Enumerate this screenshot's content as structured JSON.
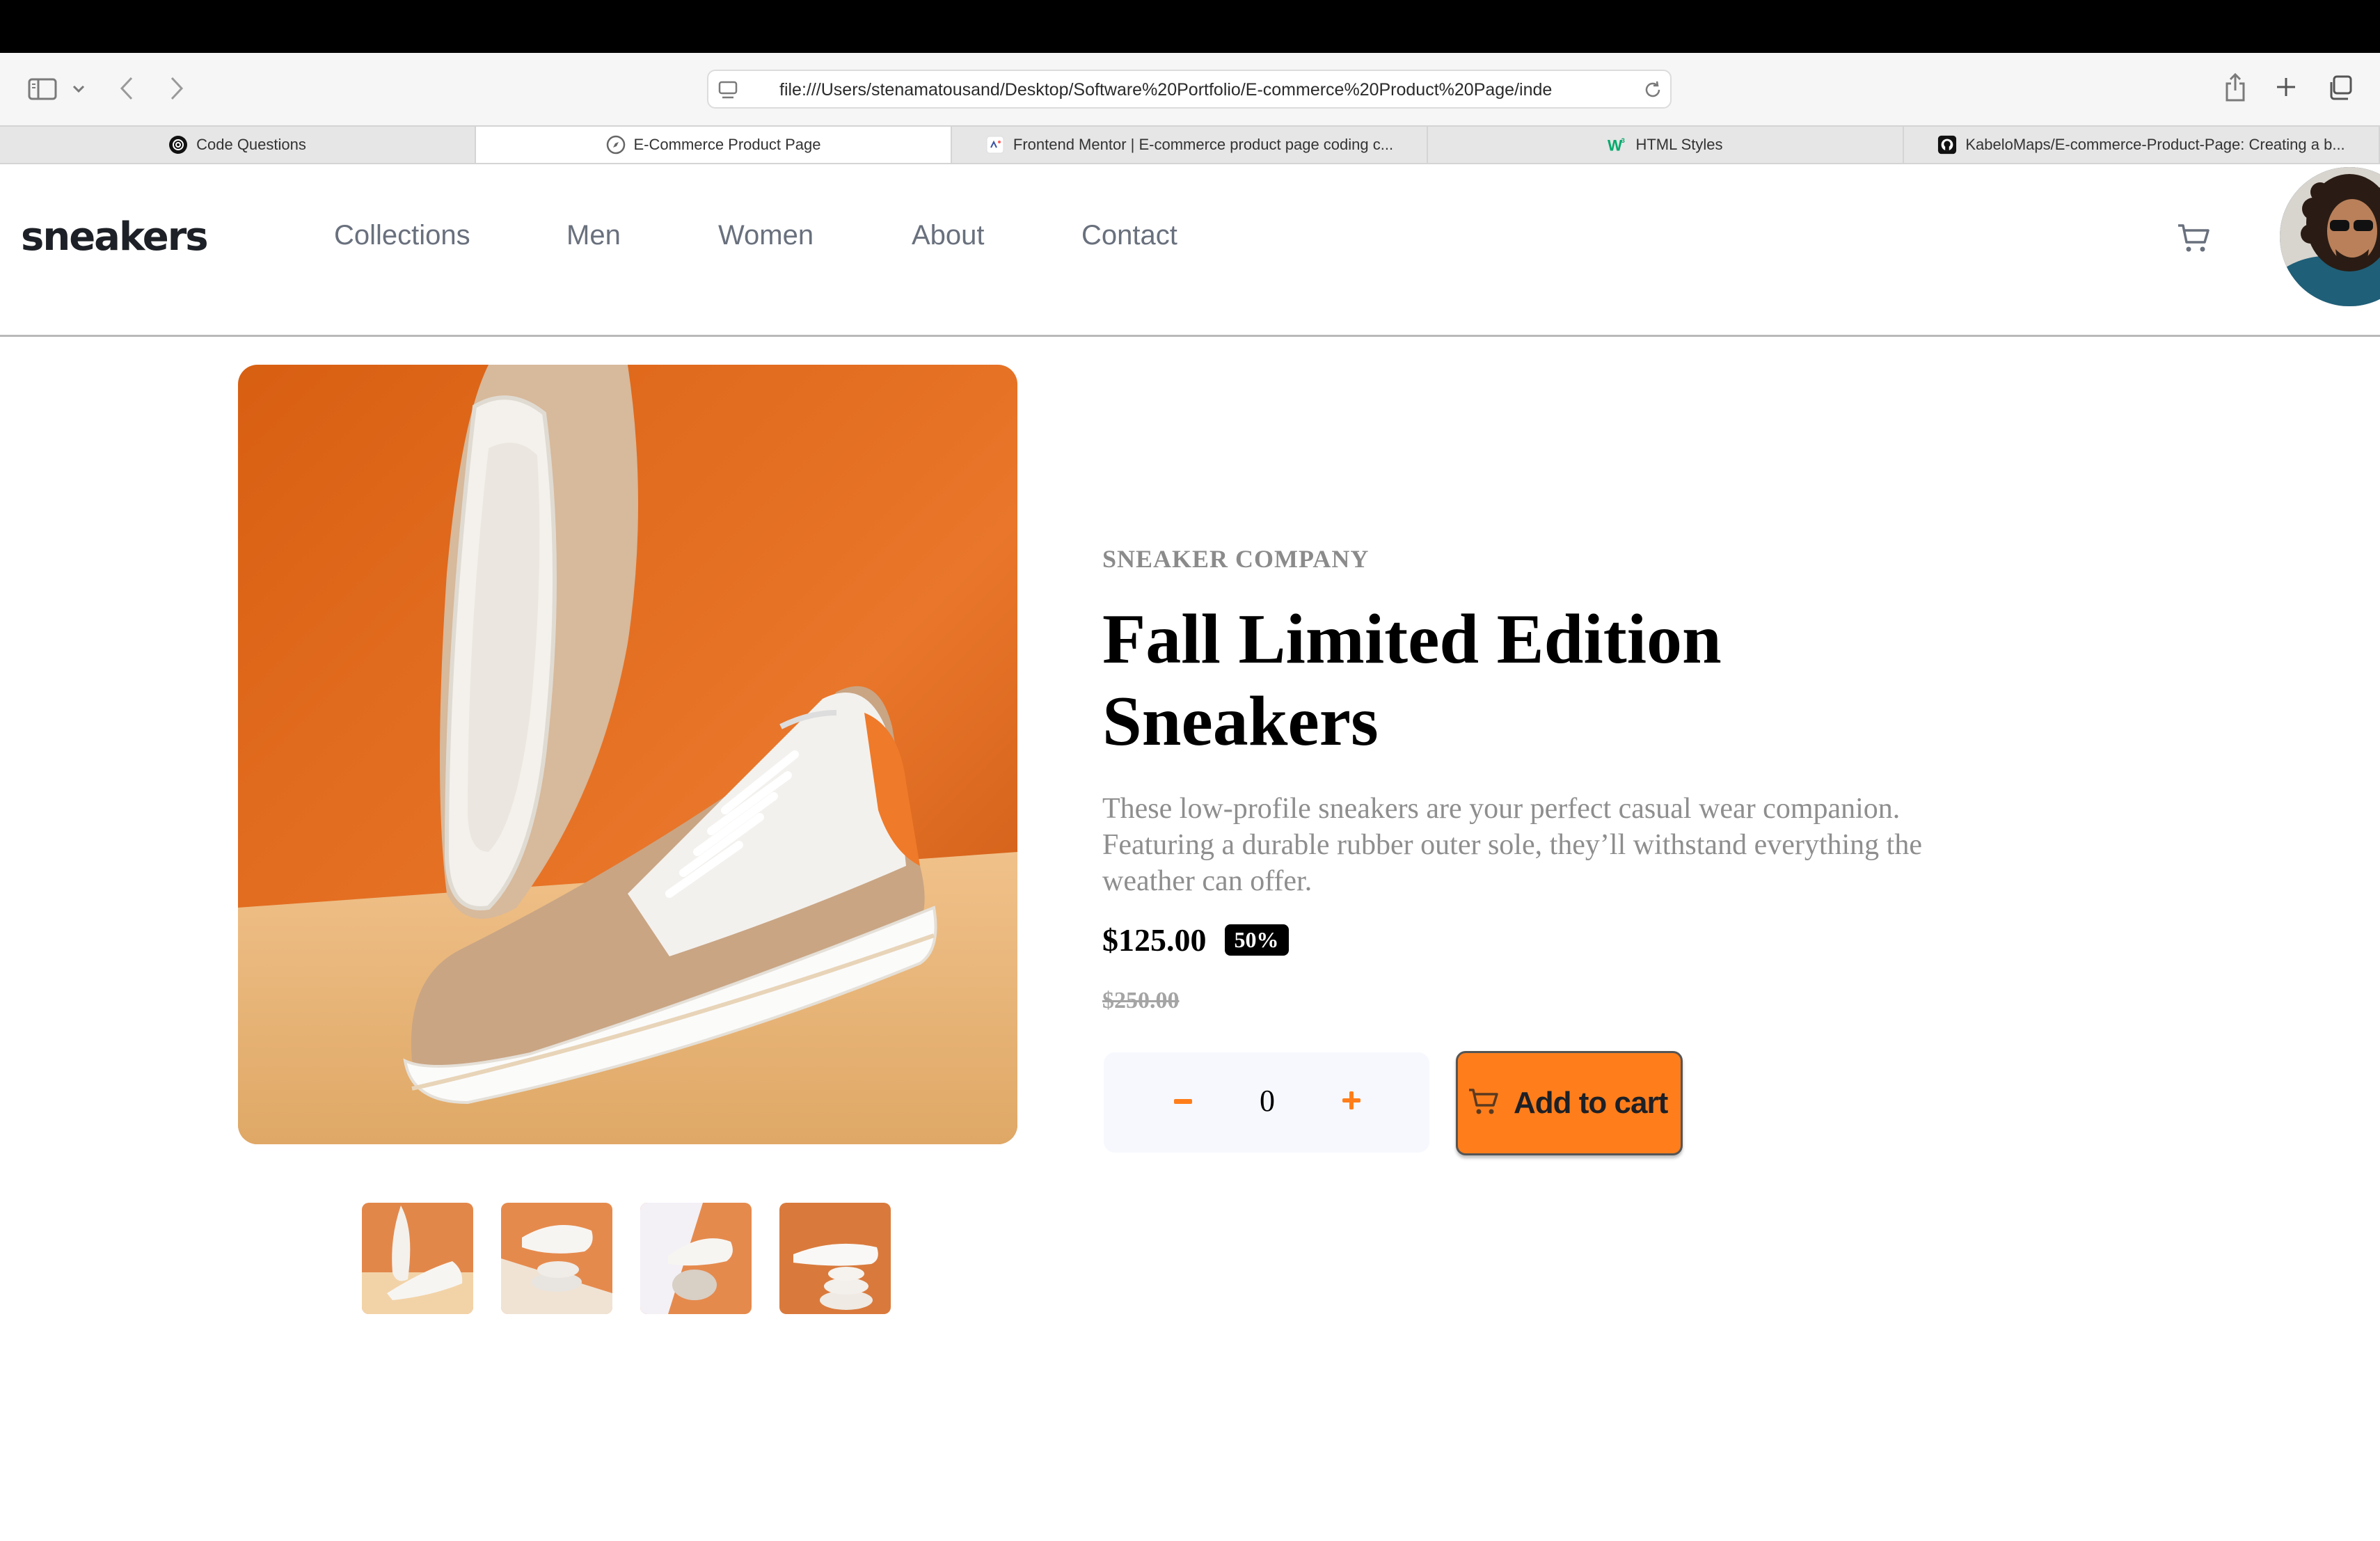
{
  "browser": {
    "url": "file:///Users/stenamatousand/Desktop/Software%20Portfolio/E-commerce%20Product%20Page/inde",
    "icons": [
      "sidebar-icon",
      "chevron-down-icon",
      "back-icon",
      "forward-icon",
      "site-settings-icon",
      "reload-icon",
      "share-icon",
      "new-tab-icon",
      "tab-overview-icon"
    ],
    "tabs": [
      {
        "label": "Code Questions",
        "icon": "openai-icon",
        "active": false
      },
      {
        "label": "E-Commerce Product Page",
        "icon": "compass-icon",
        "active": true
      },
      {
        "label": "Frontend Mentor | E-commerce product page coding c...",
        "icon": "frontend-mentor-icon",
        "active": false
      },
      {
        "label": "HTML Styles",
        "icon": "w3schools-icon",
        "active": false
      },
      {
        "label": "KabeloMaps/E-commerce-Product-Page: Creating a b...",
        "icon": "github-icon",
        "active": false
      }
    ]
  },
  "header": {
    "logo": "sneakers",
    "nav": [
      "Collections",
      "Men",
      "Women",
      "About",
      "Contact"
    ],
    "cart_icon": "cart-icon",
    "avatar": "user-avatar"
  },
  "product": {
    "company": "SNEAKER COMPANY",
    "title_line1": "Fall Limited Edition",
    "title_line2": "Sneakers",
    "description": "These low-profile sneakers are your perfect casual wear companion. Featuring a durable rubber outer sole, they’ll withstand everything the weather can offer.",
    "price": "$125.00",
    "discount": "50%",
    "old_price": "$250.00",
    "quantity": "0",
    "add_to_cart": "Add to cart",
    "thumbnail_count": 4
  },
  "colors": {
    "accent": "#ff7e1b",
    "hero_orange": "#e56a1c",
    "hero_floor": "#e8b878",
    "text_dark": "#1d2026",
    "text_grey": "#8e8e8e"
  }
}
